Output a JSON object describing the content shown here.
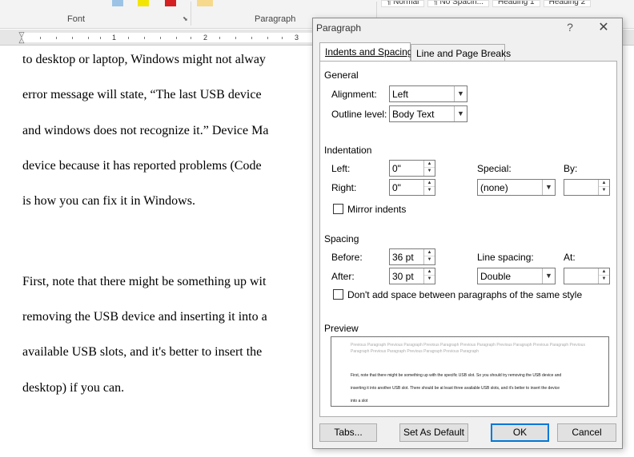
{
  "ribbon": {
    "font_group_label": "Font",
    "paragraph_group_label": "Paragraph",
    "styles": [
      "¶ Normal",
      "¶ No Spacin...",
      "Heading 1",
      "Heading 2"
    ]
  },
  "ruler": {
    "numbers": [
      "1",
      "2",
      "3"
    ]
  },
  "document": {
    "lines": [
      "to desktop or laptop, Windows might not alway",
      "error message will state, “The last USB device",
      "and windows does not recognize it.” Device Ma",
      "device because it has reported problems (Code",
      "is how you can fix it in Windows.",
      "First, note that there might be something up wit",
      "removing the USB device and inserting it into a",
      "available USB slots, and it's better to insert the",
      "desktop) if you can."
    ]
  },
  "dialog": {
    "title": "Paragraph",
    "help": "?",
    "close": "✕",
    "tabs": [
      "Indents and Spacing",
      "Line and Page Breaks"
    ],
    "general": {
      "heading": "General",
      "alignment_label": "Alignment:",
      "alignment_value": "Left",
      "outline_label": "Outline level:",
      "outline_value": "Body Text"
    },
    "indentation": {
      "heading": "Indentation",
      "left_label": "Left:",
      "left_value": "0\"",
      "right_label": "Right:",
      "right_value": "0\"",
      "special_label": "Special:",
      "special_value": "(none)",
      "by_label": "By:",
      "by_value": "",
      "mirror_label": "Mirror indents",
      "mirror_checked": false
    },
    "spacing": {
      "heading": "Spacing",
      "before_label": "Before:",
      "before_value": "36 pt",
      "after_label": "After:",
      "after_value": "30 pt",
      "line_spacing_label": "Line spacing:",
      "line_spacing_value": "Double",
      "at_label": "At:",
      "at_value": "",
      "dont_add_label": "Don't add space between paragraphs of the same style",
      "dont_add_checked": false
    },
    "preview": {
      "heading": "Preview",
      "previous_text_1": "Previous Paragraph Previous Paragraph Previous Paragraph Previous Paragraph Previous Paragraph Previous Paragraph Previous",
      "previous_text_2": "Paragraph Previous Paragraph Previous Paragraph Previous Paragraph",
      "sample_text_1": "First, note that there might be something up with the specific USB slot. So you should try removing the USB device and",
      "sample_text_2": "inserting it into another USB slot. There should be at least three available USB slots, and it's better to insert the device",
      "sample_text_3": "into a slot"
    },
    "buttons": {
      "tabs": "Tabs...",
      "set_default": "Set As Default",
      "ok": "OK",
      "cancel": "Cancel"
    }
  },
  "colors": {
    "default_button_border": "#0078d7",
    "dialog_background": "#f0f0f0"
  }
}
